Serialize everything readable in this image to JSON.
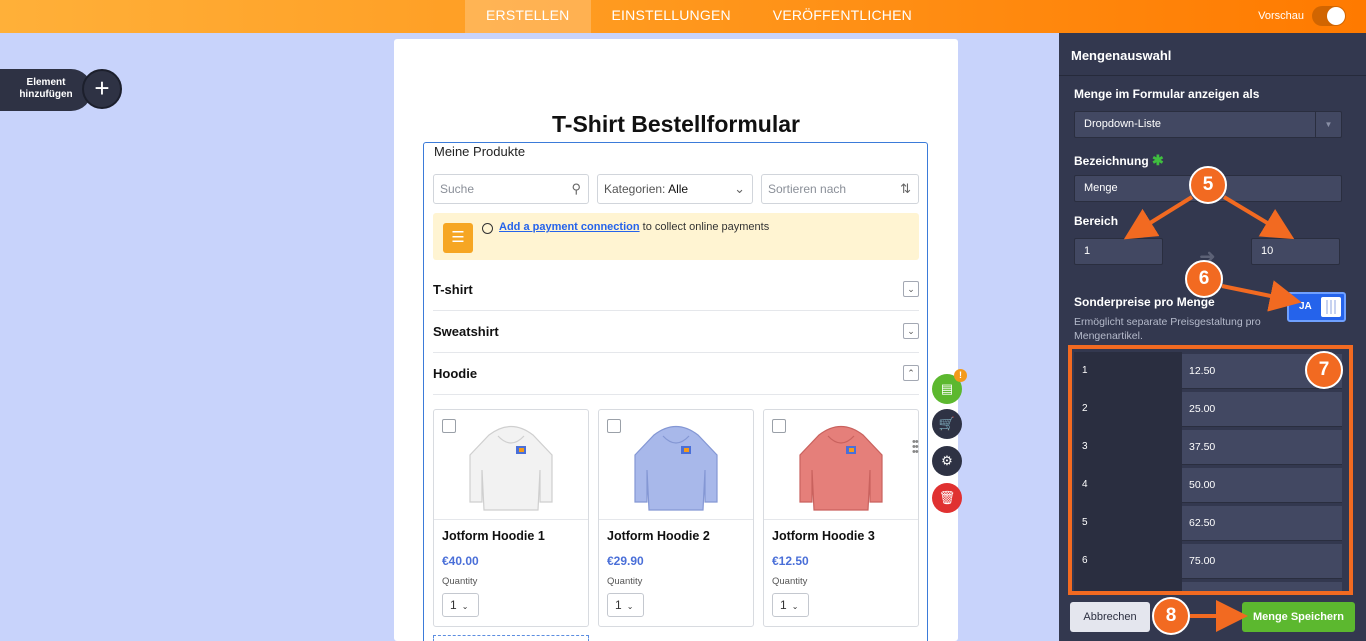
{
  "topbar": {
    "tabs": [
      {
        "label": "ERSTELLEN",
        "active": true
      },
      {
        "label": "EINSTELLUNGEN",
        "active": false
      },
      {
        "label": "VERÖFFENTLICHEN",
        "active": false
      }
    ],
    "preview_label": "Vorschau"
  },
  "add_element": {
    "label_line1": "Element",
    "label_line2": "hinzufügen"
  },
  "form": {
    "title": "T-Shirt Bestellformular",
    "products_label": "Meine Produkte",
    "search_placeholder": "Suche",
    "categories_prefix": "Kategorien: ",
    "categories_value": "Alle",
    "sort_placeholder": "Sortieren nach",
    "payment_link": "Add a payment connection",
    "payment_text": " to collect online payments",
    "sections": [
      "T-shirt",
      "Sweatshirt",
      "Hoodie"
    ],
    "products": [
      {
        "name": "Jotform Hoodie 1",
        "price": "€40.00",
        "qty_label": "Quantity",
        "qty": "1",
        "color": "#f2f2f2"
      },
      {
        "name": "Jotform Hoodie 2",
        "price": "€29.90",
        "qty_label": "Quantity",
        "qty": "1",
        "color": "#a8b8ea"
      },
      {
        "name": "Jotform Hoodie 3",
        "price": "€12.50",
        "qty_label": "Quantity",
        "qty": "1",
        "color": "#e57f7a"
      }
    ]
  },
  "panel": {
    "title": "Mengenauswahl",
    "display_label": "Menge im Formular anzeigen als",
    "display_value": "Dropdown-Liste",
    "name_label": "Bezeichnung",
    "name_value": "Menge",
    "range_label": "Bereich",
    "range_from": "1",
    "range_to": "10",
    "special_label": "Sonderpreise pro Menge",
    "special_toggle": "JA",
    "special_desc": "Ermöglicht separate Preisgestaltung pro Mengenartikel.",
    "rows": [
      {
        "qty": "1",
        "price": "12.50"
      },
      {
        "qty": "2",
        "price": "25.00"
      },
      {
        "qty": "3",
        "price": "37.50"
      },
      {
        "qty": "4",
        "price": "50.00"
      },
      {
        "qty": "5",
        "price": "62.50"
      },
      {
        "qty": "6",
        "price": "75.00"
      }
    ],
    "cancel_label": "Abbrechen",
    "save_label": "Menge Speichern"
  },
  "annotations": [
    "5",
    "6",
    "7",
    "8"
  ],
  "colors": {
    "accent": "#ff8a00",
    "annotation": "#f26a21",
    "save": "#5cb82f",
    "toggle": "#2563eb"
  }
}
